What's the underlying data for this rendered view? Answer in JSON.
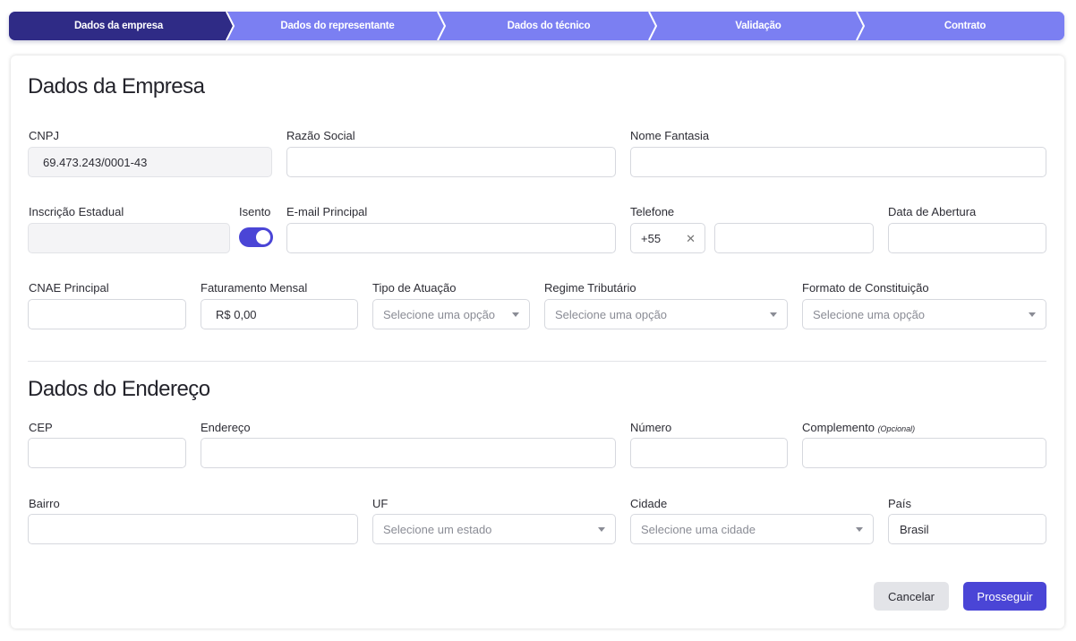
{
  "stepper": {
    "steps": [
      "Dados da empresa",
      "Dados do representante",
      "Dados do técnico",
      "Validação",
      "Contrato"
    ]
  },
  "company": {
    "title": "Dados da Empresa",
    "cnpj": {
      "label": "CNPJ",
      "value": "69.473.243/0001-43"
    },
    "razao_social": {
      "label": "Razão Social",
      "value": ""
    },
    "nome_fantasia": {
      "label": "Nome Fantasia",
      "value": ""
    },
    "inscricao_estadual": {
      "label": "Inscrição Estadual",
      "value": ""
    },
    "isento": {
      "label": "Isento",
      "checked": true
    },
    "email": {
      "label": "E-mail Principal",
      "value": ""
    },
    "telefone": {
      "label": "Telefone",
      "prefix": "+55",
      "clear": "✕",
      "value": ""
    },
    "data_abertura": {
      "label": "Data de Abertura",
      "value": ""
    },
    "cnae": {
      "label": "CNAE Principal",
      "value": ""
    },
    "faturamento": {
      "label": "Faturamento Mensal",
      "value": "R$ 0,00"
    },
    "tipo_atuacao": {
      "label": "Tipo de Atuação",
      "placeholder": "Selecione uma opção"
    },
    "regime_tributario": {
      "label": "Regime Tributário",
      "placeholder": "Selecione uma opção"
    },
    "formato_constituicao": {
      "label": "Formato de Constituição",
      "placeholder": "Selecione uma opção"
    }
  },
  "address": {
    "title": "Dados do Endereço",
    "cep": {
      "label": "CEP",
      "value": ""
    },
    "endereco": {
      "label": "Endereço",
      "value": ""
    },
    "numero": {
      "label": "Número",
      "value": ""
    },
    "complemento": {
      "label": "Complemento",
      "optional": "(Opcional)",
      "value": ""
    },
    "bairro": {
      "label": "Bairro",
      "value": ""
    },
    "uf": {
      "label": "UF",
      "placeholder": "Selecione um estado"
    },
    "cidade": {
      "label": "Cidade",
      "placeholder": "Selecione uma cidade"
    },
    "pais": {
      "label": "País",
      "value": "Brasil"
    }
  },
  "actions": {
    "cancel": "Cancelar",
    "next": "Prosseguir"
  },
  "colors": {
    "primary": "#4a45d6",
    "step_active": "#2f2b86",
    "step_inactive": "#7b7ff2"
  }
}
